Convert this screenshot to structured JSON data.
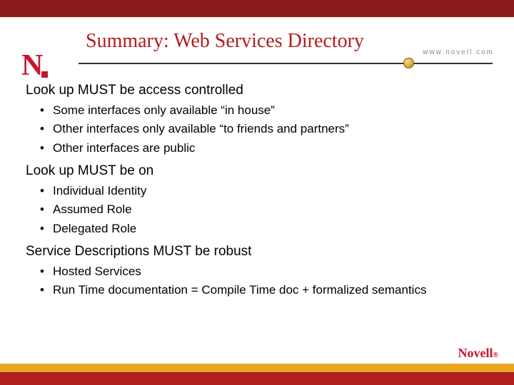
{
  "header": {
    "title": "Summary: Web Services Directory",
    "url": "www.novell.com"
  },
  "sections": [
    {
      "heading": "Look up MUST be access controlled",
      "items": [
        "Some interfaces only available “in house”",
        "Other interfaces only available “to friends and partners”",
        "Other interfaces are public"
      ]
    },
    {
      "heading": "Look up MUST be on",
      "items": [
        "Individual Identity",
        "Assumed Role",
        "Delegated Role"
      ]
    },
    {
      "heading": "Service Descriptions MUST be robust",
      "items": [
        "Hosted Services",
        "Run Time documentation = Compile Time doc + formalized semantics"
      ]
    }
  ],
  "brand": {
    "name": "Novell",
    "logo_letter": "N"
  }
}
